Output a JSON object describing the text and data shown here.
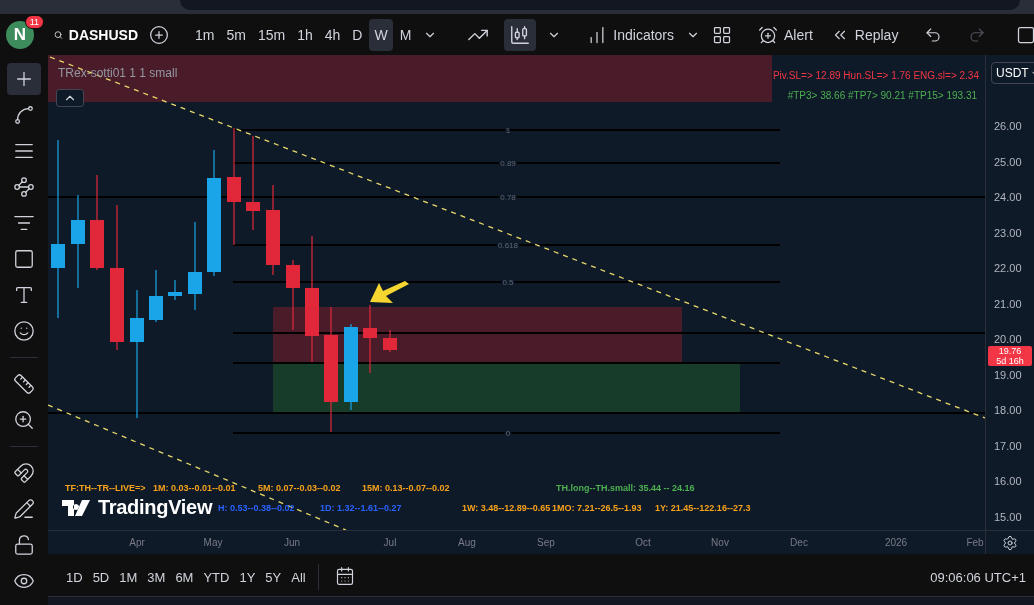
{
  "toolbar": {
    "avatar": "N",
    "notifications": "11",
    "symbol": "DASHUSD",
    "intervals": [
      {
        "label": "1m",
        "selected": false
      },
      {
        "label": "5m",
        "selected": false
      },
      {
        "label": "15m",
        "selected": false
      },
      {
        "label": "1h",
        "selected": false
      },
      {
        "label": "4h",
        "selected": false
      },
      {
        "label": "D",
        "selected": false
      },
      {
        "label": "W",
        "selected": true
      },
      {
        "label": "M",
        "selected": false
      }
    ],
    "chart_types": [
      {
        "kind": "line",
        "selected": false
      },
      {
        "kind": "candles",
        "selected": true
      }
    ],
    "indicators": "Indicators",
    "alert": "Alert",
    "replay": "Replay",
    "redo_disabled": true
  },
  "drawing_tools": [
    {
      "kind": "crosshair",
      "selected": true
    },
    {
      "kind": "trend-line",
      "selected": false
    },
    {
      "kind": "horizontal-lines",
      "selected": false
    },
    {
      "kind": "pattern",
      "selected": false
    },
    {
      "kind": "fib",
      "selected": false
    },
    {
      "kind": "rectangle",
      "selected": false
    },
    {
      "kind": "text",
      "selected": false
    },
    {
      "kind": "emoji",
      "selected": false
    },
    {
      "kind": "ruler",
      "selected": false
    },
    {
      "kind": "zoom",
      "selected": false
    },
    {
      "kind": "magnet",
      "selected": false
    },
    {
      "kind": "pencil",
      "selected": false
    },
    {
      "kind": "lock",
      "selected": false
    },
    {
      "kind": "eye",
      "selected": false
    }
  ],
  "chart": {
    "legend": "TRex-sotti01 1 1 small",
    "currency": "USDT",
    "stop_info": "Piv.SL=> 12.89  Hun.SL=> 1.76  ENG.sl=> 2.34",
    "tp_info": "#TP3> 38.66  #TP7> 90.21  #TP15> 193.31",
    "fib_levels": [
      "1",
      "0.89",
      "0.78",
      "0.618",
      "0.5",
      "0"
    ],
    "price_ticks": [
      "26.00",
      "25.00",
      "24.00",
      "23.00",
      "22.00",
      "21.00",
      "20.00",
      "19.00",
      "18.00",
      "17.00",
      "16.00",
      "15.00"
    ],
    "last_price": "19.76",
    "countdown": "5d 16h",
    "stats_row1": [
      {
        "text": "TF:TH--TR--LIVE=>",
        "color": "#f7a21b"
      },
      {
        "text": "1M: 0.03--0.01--0.01",
        "color": "#f7a21b"
      },
      {
        "text": "5M: 0.07--0.03--0.02",
        "color": "#f7a21b"
      },
      {
        "text": "15M: 0.13--0.07--0.02",
        "color": "#f7a21b"
      },
      {
        "text": "TH.long--TH.small: 35.44 -- 24.16",
        "color": "#4caf50"
      }
    ],
    "stats_row2": [
      {
        "text": "H: 0.53--0.38--0.02",
        "color": "#2962ff"
      },
      {
        "text": "1D: 1.32--1.61--0.27",
        "color": "#2962ff"
      },
      {
        "text": "1W: 3.48--12.89--0.65",
        "color": "#f7a21b"
      },
      {
        "text": "1MO: 7.21--26.5--1.93",
        "color": "#f7a21b"
      },
      {
        "text": "1Y: 21.45--122.16--27.3",
        "color": "#f7a21b"
      }
    ],
    "watermark_logo": "TradingView",
    "time_ticks": [
      "Apr",
      "May",
      "Jun",
      "Jul",
      "Aug",
      "Sep",
      "Oct",
      "Nov",
      "Dec",
      "2026",
      "Feb"
    ]
  },
  "range_buttons": [
    "1D",
    "5D",
    "1M",
    "3M",
    "6M",
    "YTD",
    "1Y",
    "5Y",
    "All"
  ],
  "clock": "09:06:06 UTC+1"
}
